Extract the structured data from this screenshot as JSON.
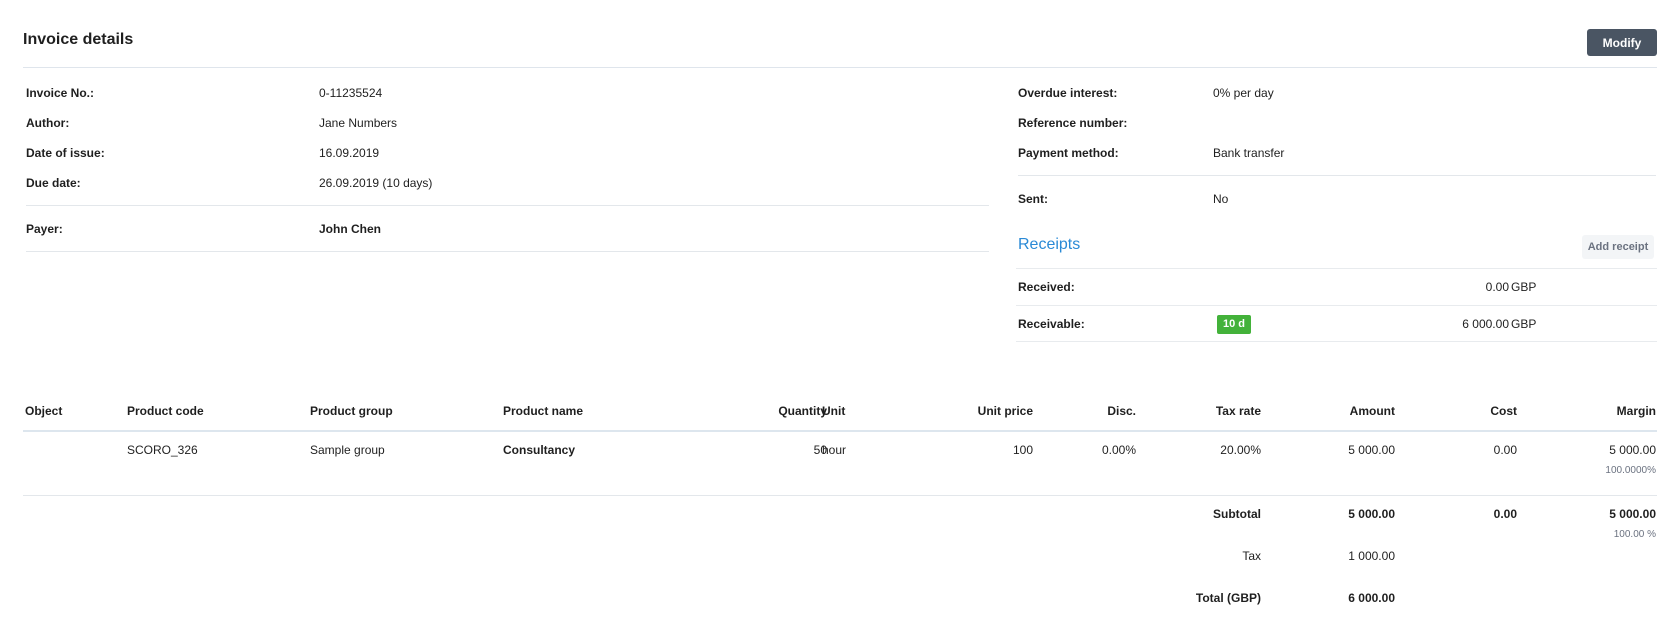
{
  "header": {
    "title": "Invoice details",
    "modify_label": "Modify"
  },
  "details_left": [
    {
      "label": "Invoice No.:",
      "value": "0-11235524"
    },
    {
      "label": "Author:",
      "value": "Jane Numbers"
    },
    {
      "label": "Date of issue:",
      "value": "16.09.2019"
    },
    {
      "label": "Due date:",
      "value": "26.09.2019 (10 days)"
    }
  ],
  "payer": {
    "label": "Payer:",
    "value": "John Chen"
  },
  "details_right": [
    {
      "label": "Overdue interest:",
      "value": "0% per day"
    },
    {
      "label": "Reference number:",
      "value": ""
    },
    {
      "label": "Payment method:",
      "value": "Bank transfer"
    }
  ],
  "sent": {
    "label": "Sent:",
    "value": "No"
  },
  "receipts": {
    "title": "Receipts",
    "add_label": "Add receipt",
    "received": {
      "label": "Received:",
      "amount": "0.00",
      "currency": "GBP"
    },
    "receivable": {
      "label": "Receivable:",
      "badge": "10 d",
      "amount": "6 000.00",
      "currency": "GBP"
    }
  },
  "table": {
    "columns": {
      "object": "Object",
      "product_code": "Product code",
      "product_group": "Product group",
      "product_name": "Product name",
      "quantity": "Quantity",
      "unit": "Unit",
      "unit_price": "Unit price",
      "disc": "Disc.",
      "tax_rate": "Tax rate",
      "amount": "Amount",
      "cost": "Cost",
      "margin": "Margin"
    },
    "rows": [
      {
        "object": "",
        "product_code": "SCORO_326",
        "product_group": "Sample group",
        "product_name": "Consultancy",
        "quantity": "50",
        "unit": "hour",
        "unit_price": "100",
        "disc": "0.00%",
        "tax_rate": "20.00%",
        "amount": "5 000.00",
        "cost": "0.00",
        "margin": "5 000.00",
        "margin_pct": "100.0000%"
      }
    ],
    "totals": {
      "subtotal_label": "Subtotal",
      "subtotal_amount": "5 000.00",
      "subtotal_cost": "0.00",
      "subtotal_margin": "5 000.00",
      "subtotal_margin_pct": "100.00 %",
      "tax_label": "Tax",
      "tax_amount": "1 000.00",
      "total_label": "Total (GBP)",
      "total_amount": "6 000.00"
    }
  },
  "colors": {
    "accent": "#2a8ad6",
    "badge_green": "#43b23a",
    "button_dark": "#4a5563"
  }
}
